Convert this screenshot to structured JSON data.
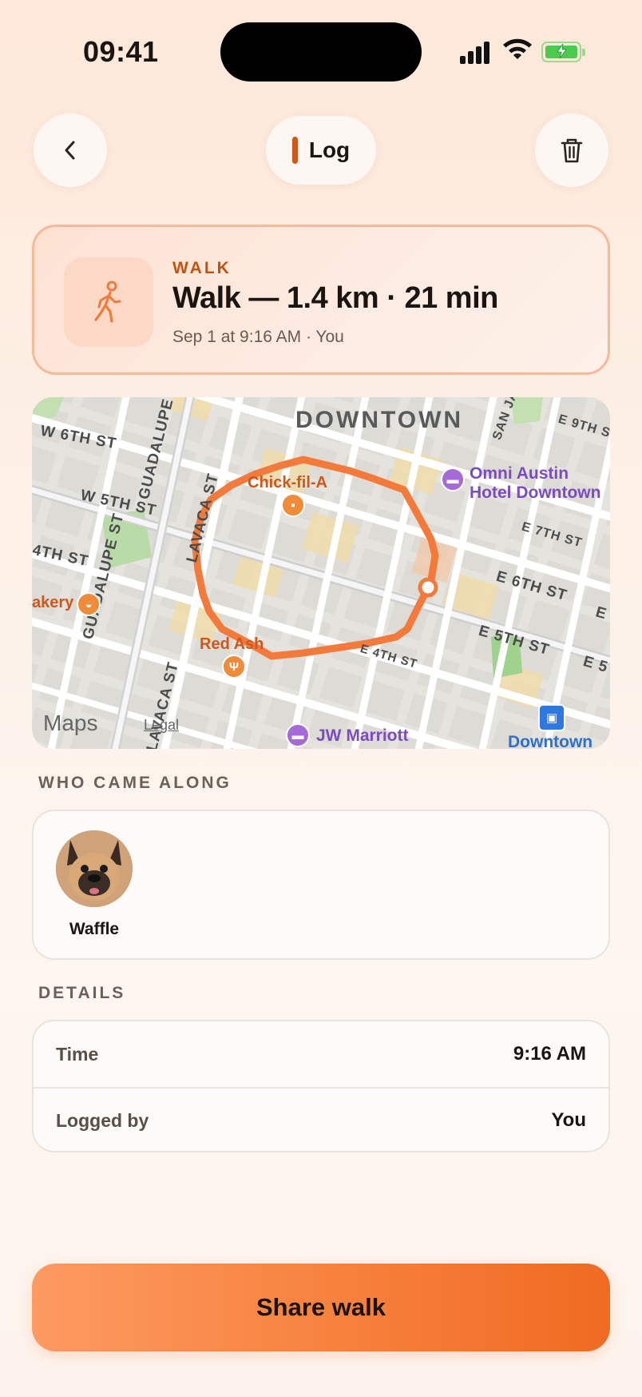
{
  "status_bar": {
    "time": "09:41"
  },
  "nav": {
    "log_label": "Log"
  },
  "activity": {
    "category": "WALK",
    "title": "Walk — 1.4 km · 21 min",
    "subtitle": "Sep 1 at 9:16 AM · You"
  },
  "map": {
    "district": "DOWNTOWN",
    "streets": [
      "W 6TH ST",
      "W 5TH ST",
      "4TH ST",
      "GUADALUPE ST",
      "LAVACA ST",
      "SAN JA",
      "E 9TH S",
      "E 7TH ST",
      "E 6TH ST",
      "E 5TH ST",
      "E 4TH ST",
      "E 5",
      "E",
      "ST"
    ],
    "pois": {
      "chick": "Chick-fil-A",
      "omni": "Omni Austin",
      "omni2": "Hotel Downtown",
      "bakery": "akery",
      "redash": "Red Ash",
      "jw": "JW Marriott",
      "downtown_station": "Downtown"
    },
    "maps_label": "Maps",
    "legal_label": "Legal",
    "route_color": "#f47a3c"
  },
  "companions": {
    "heading": "WHO CAME ALONG",
    "items": [
      {
        "name": "Waffle"
      }
    ]
  },
  "details": {
    "heading": "DETAILS",
    "rows": [
      {
        "label": "Time",
        "value": "9:16 AM"
      },
      {
        "label": "Logged by",
        "value": "You"
      }
    ]
  },
  "actions": {
    "share_label": "Share walk"
  },
  "colors": {
    "accent": "#f06a22",
    "category": "#c4520f"
  }
}
